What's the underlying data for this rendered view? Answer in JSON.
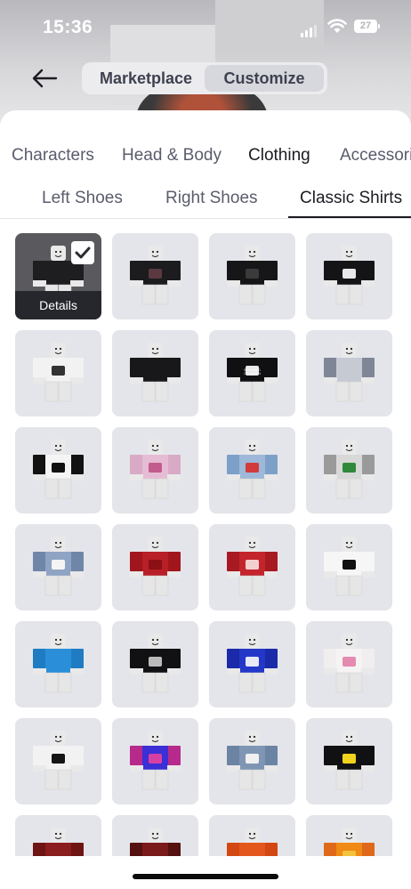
{
  "status_bar": {
    "time": "15:36",
    "battery": "27"
  },
  "header": {
    "segments": [
      "Marketplace",
      "Customize"
    ],
    "selected": "Customize"
  },
  "categories": [
    "Characters",
    "Head & Body",
    "Clothing",
    "Accessories"
  ],
  "category_selected": "Clothing",
  "subcategories": [
    "Left Shoes",
    "Right Shoes",
    "Classic Shirts"
  ],
  "subcategory_selected": "Classic Shirts",
  "selected_item": {
    "details_label": "Details"
  },
  "shirts": [
    {
      "color": "#1e1e20",
      "sleeve": "#1e1e20",
      "print": "",
      "selected": true
    },
    {
      "color": "#1c1c1f",
      "sleeve": "#1c1c1f",
      "print": "#5a3a40"
    },
    {
      "color": "#161618",
      "sleeve": "#161618",
      "print": "#3a3a3a"
    },
    {
      "color": "#141416",
      "sleeve": "#141416",
      "print": "#e8e8e8"
    },
    {
      "color": "#f2f2f2",
      "sleeve": "#f2f2f2",
      "print": "#333"
    },
    {
      "color": "#18181a",
      "sleeve": "#18181a",
      "print": ""
    },
    {
      "color": "#101012",
      "sleeve": "#101012",
      "print": "#e8e8e8",
      "text": "IM SCARED OF WOMEN"
    },
    {
      "color": "#c6cad3",
      "sleeve": "#7f8696",
      "print": ""
    },
    {
      "color": "#f4f4f4",
      "sleeve": "#121212",
      "print": "#111"
    },
    {
      "color": "#e5bcd4",
      "sleeve": "#d9aac5",
      "print": "#c25b8e"
    },
    {
      "color": "#9db8d8",
      "sleeve": "#7da0c8",
      "print": "#d23b3b"
    },
    {
      "color": "#d8d8d8",
      "sleeve": "#9a9a9a",
      "print": "#2e8a3a"
    },
    {
      "color": "#8fa4c4",
      "sleeve": "#6f86a8",
      "print": "#f4f4f4"
    },
    {
      "color": "#b81f26",
      "sleeve": "#a0161c",
      "print": "#8c0f15"
    },
    {
      "color": "#c4242c",
      "sleeve": "#a81a22",
      "print": "#f2d0d0"
    },
    {
      "color": "#f6f6f6",
      "sleeve": "#f6f6f6",
      "print": "#111"
    },
    {
      "color": "#2a8fd8",
      "sleeve": "#1f7cc2",
      "print": ""
    },
    {
      "color": "#111113",
      "sleeve": "#111113",
      "print": "#bbb"
    },
    {
      "color": "#2437c8",
      "sleeve": "#1a2aa8",
      "print": "#e8e8f8"
    },
    {
      "color": "#f5f3f3",
      "sleeve": "#f0eeee",
      "print": "#e58ab0"
    },
    {
      "color": "#f2f2f2",
      "sleeve": "#f2f2f2",
      "print": "#151515"
    },
    {
      "color": "#3b2fd6",
      "sleeve": "#b72a8b",
      "print": "#d640a2"
    },
    {
      "color": "#7e96b3",
      "sleeve": "#6b84a3",
      "print": "#f0f0f0"
    },
    {
      "color": "#111113",
      "sleeve": "#111113",
      "print": "#f2d21c"
    },
    {
      "color": "#8a1d1d",
      "sleeve": "#6e1414",
      "print": ""
    },
    {
      "color": "#7a1a1a",
      "sleeve": "#551010",
      "print": ""
    },
    {
      "color": "#e4571c",
      "sleeve": "#d34812",
      "print": ""
    },
    {
      "color": "#f08a16",
      "sleeve": "#e0681a",
      "print": "#f4c23c"
    }
  ]
}
